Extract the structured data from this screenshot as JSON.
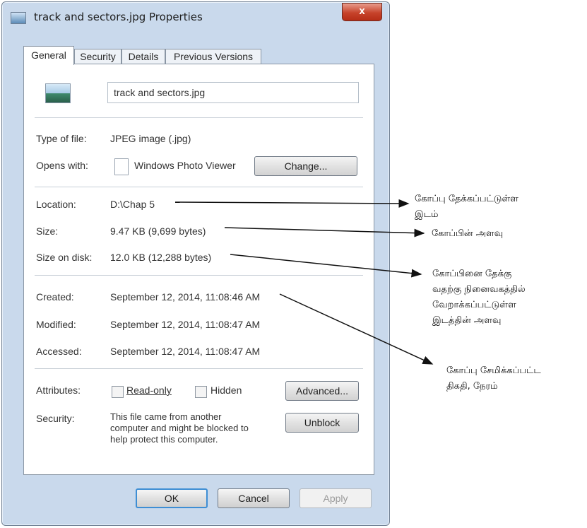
{
  "window": {
    "title": "track and sectors.jpg Properties",
    "close_label": "x"
  },
  "tabs": [
    {
      "label": "General",
      "active": true
    },
    {
      "label": "Security",
      "active": false
    },
    {
      "label": "Details",
      "active": false
    },
    {
      "label": "Previous Versions",
      "active": false
    }
  ],
  "general": {
    "file_name": "track and sectors.jpg",
    "type_label": "Type of file:",
    "type_value": "JPEG image (.jpg)",
    "opens_label": "Opens with:",
    "opens_value": "Windows Photo Viewer",
    "change_button": "Change...",
    "location_label": "Location:",
    "location_value": "D:\\Chap 5",
    "size_label": "Size:",
    "size_value": "9.47 KB (9,699 bytes)",
    "size_disk_label": "Size on disk:",
    "size_disk_value": "12.0 KB (12,288 bytes)",
    "created_label": "Created:",
    "created_value": "September 12, 2014, 11:08:46 AM",
    "modified_label": "Modified:",
    "modified_value": "September 12, 2014, 11:08:47 AM",
    "accessed_label": "Accessed:",
    "accessed_value": "September 12, 2014, 11:08:47 AM",
    "attributes_label": "Attributes:",
    "readonly_label": "Read-only",
    "hidden_label": "Hidden",
    "advanced_button": "Advanced...",
    "security_label": "Security:",
    "security_text_1": "This file came from another",
    "security_text_2": "computer and might be blocked to",
    "security_text_3": "help protect this computer.",
    "unblock_button": "Unblock"
  },
  "footer": {
    "ok": "OK",
    "cancel": "Cancel",
    "apply": "Apply"
  },
  "annotations": {
    "location_1": "கோப்பு தேக்கப்பட்டுள்ள",
    "location_2": "இடம்",
    "size": "கோப்பின் அளவு",
    "disk_1": "கோப்பினை தேக்கு",
    "disk_2": "வதற்கு நினைவகத்தில்",
    "disk_3": "வேறாக்கப்பட்டுள்ள",
    "disk_4": "இடத்தின் அளவு",
    "created_1": "கோப்பு சேமிக்கப்பட்ட",
    "created_2": "திகதி, நேரம்"
  },
  "colors": {
    "window_frame": "#c9d9ec",
    "close_button": "#c7432b",
    "focus_border": "#3e8ed4"
  }
}
